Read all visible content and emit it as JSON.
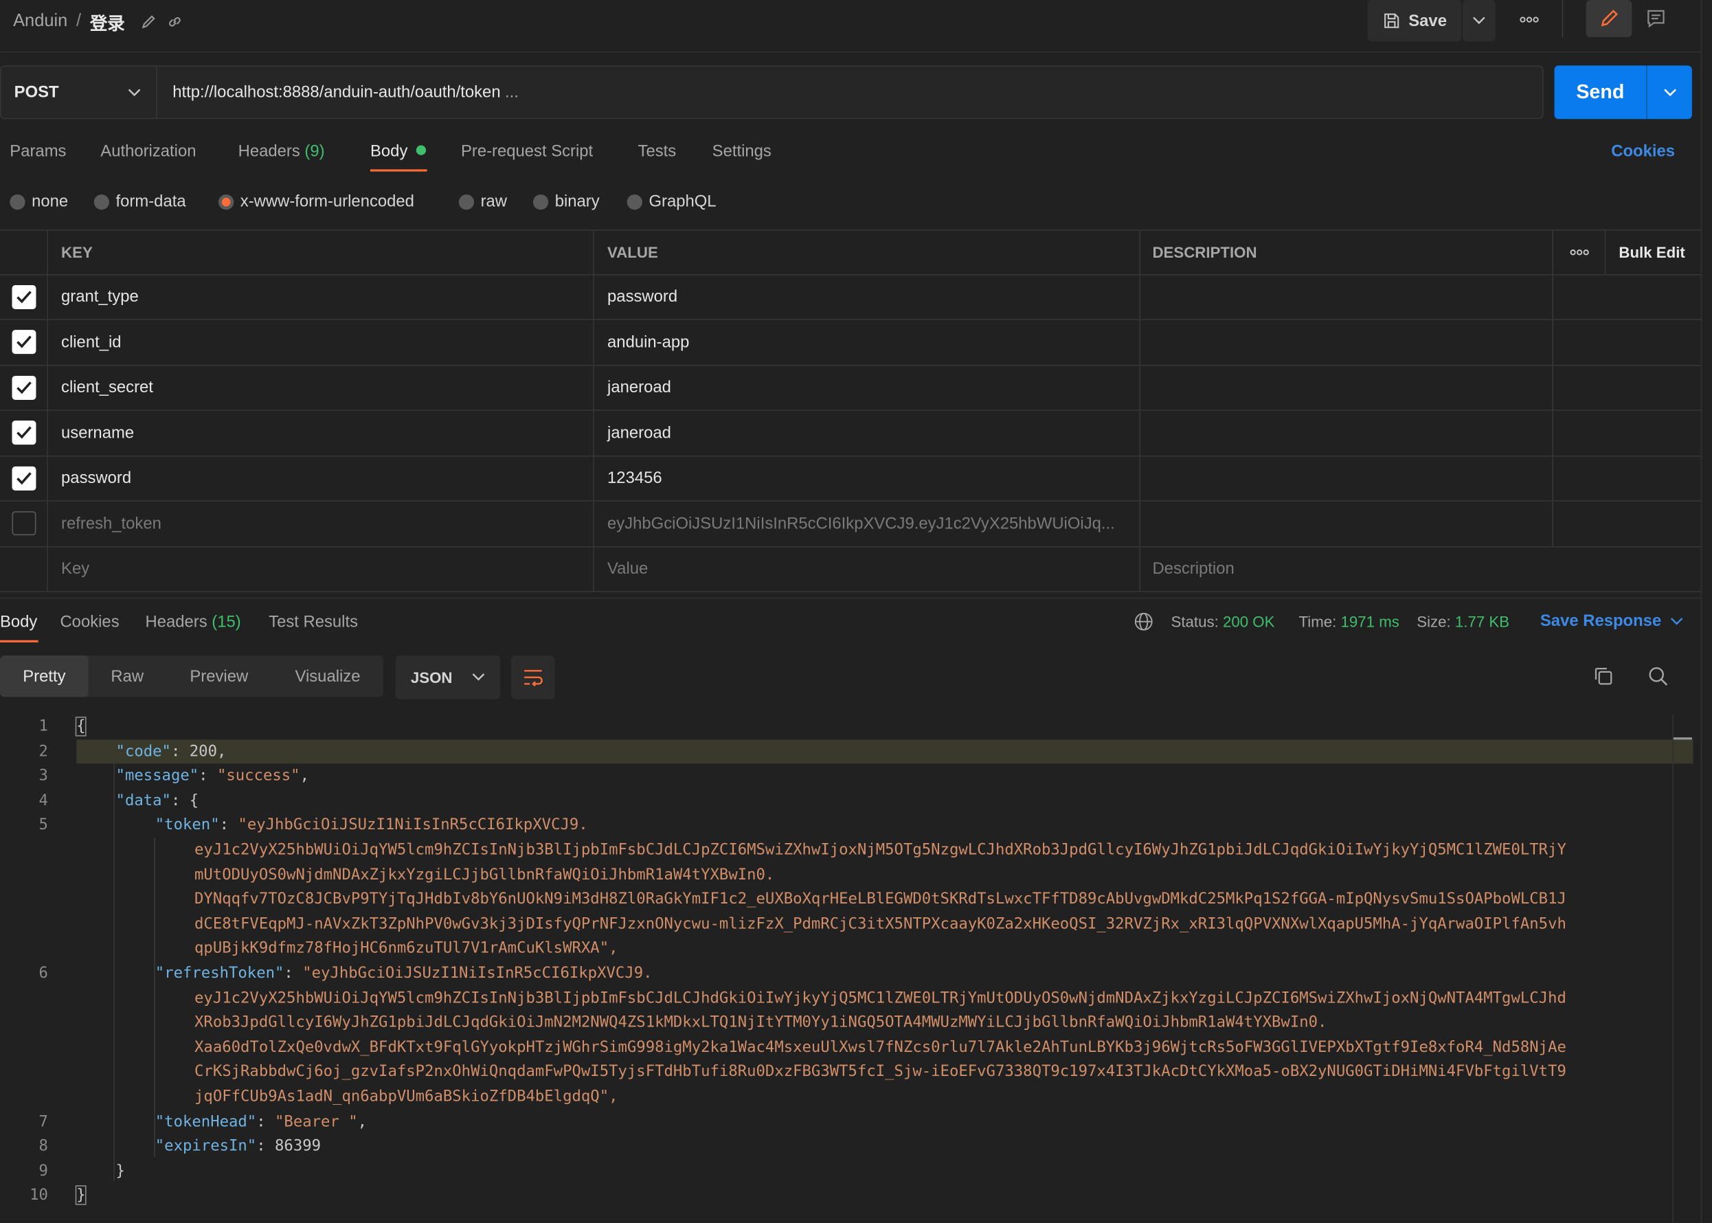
{
  "header": {
    "workspace": "Anduin",
    "separator": "/",
    "request_name": "登录",
    "save_label": "Save",
    "more_label": "ooo"
  },
  "request": {
    "method": "POST",
    "url": "http://localhost:8888/anduin-auth/oauth/token",
    "url_ellipsis": "...",
    "send_label": "Send"
  },
  "tabs": {
    "params": "Params",
    "authorization": "Authorization",
    "headers": "Headers",
    "headers_count": "(9)",
    "body": "Body",
    "prerequest": "Pre-request Script",
    "tests": "Tests",
    "settings": "Settings",
    "cookies": "Cookies"
  },
  "body_types": {
    "none": "none",
    "form_data": "form-data",
    "urlencoded": "x-www-form-urlencoded",
    "raw": "raw",
    "binary": "binary",
    "graphql": "GraphQL"
  },
  "table": {
    "headers": {
      "key": "KEY",
      "value": "VALUE",
      "description": "DESCRIPTION",
      "more": "ooo",
      "bulk_edit": "Bulk Edit"
    },
    "rows": [
      {
        "checked": true,
        "key": "grant_type",
        "value": "password"
      },
      {
        "checked": true,
        "key": "client_id",
        "value": "anduin-app"
      },
      {
        "checked": true,
        "key": "client_secret",
        "value": "janeroad"
      },
      {
        "checked": true,
        "key": "username",
        "value": "janeroad"
      },
      {
        "checked": true,
        "key": "password",
        "value": "123456"
      },
      {
        "checked": false,
        "key": "refresh_token",
        "value": "eyJhbGciOiJSUzI1NiIsInR5cCI6IkpXVCJ9.eyJ1c2VyX25hbWUiOiJq..."
      }
    ],
    "placeholder": {
      "key": "Key",
      "value": "Value",
      "description": "Description"
    }
  },
  "response": {
    "tabs": {
      "body": "Body",
      "cookies": "Cookies",
      "headers": "Headers",
      "headers_count": "(15)",
      "test_results": "Test Results"
    },
    "status_label": "Status:",
    "status_value": "200 OK",
    "time_label": "Time:",
    "time_value": "1971 ms",
    "size_label": "Size:",
    "size_value": "1.77 KB",
    "save_response": "Save Response",
    "view_modes": {
      "pretty": "Pretty",
      "raw": "Raw",
      "preview": "Preview",
      "visualize": "Visualize"
    },
    "format": "JSON",
    "code": {
      "open_brace": "{",
      "close_brace": "}",
      "code_key": "\"code\"",
      "code_val": "200",
      "message_key": "\"message\"",
      "message_val": "\"success\"",
      "data_key": "\"data\"",
      "token_key": "\"token\"",
      "token_lines": [
        "\"eyJhbGciOiJSUzI1NiIsInR5cCI6IkpXVCJ9.",
        "eyJ1c2VyX25hbWUiOiJqYW5lcm9hZCIsInNjb3BlIjpbImFsbCJdLCJpZCI6MSwiZXhwIjoxNjM5OTg5NzgwLCJhdXRob3JpdGllcyI6WyJhZG1pbiJdLCJqdGkiOiIwYjkyYjQ5MC1lZWE0LTRjY",
        "mUtODUyOS0wNjdmNDAxZjkxYzgiLCJjbGllbnRfaWQiOiJhbmR1aW4tYXBwIn0.",
        "DYNqqfv7TOzC8JCBvP9TYjTqJHdbIv8bY6nUOkN9iM3dH8Zl0RaGkYmIF1c2_eUXBoXqrHEeLBlEGWD0tSKRdTsLwxcTFfTD89cAbUvgwDMkdC25MkPq1S2fGGA-mIpQNysvSmu1SsOAPboWLCB1J",
        "dCE8tFVEqpMJ-nAVxZkT3ZpNhPV0wGv3kj3jDIsfyQPrNFJzxnONycwu-mlizFzX_PdmRCjC3itX5NTPXcaayK0Za2xHKeoQSI_32RVZjRx_xRI3lqQPVXNXwlXqapU5MhA-jYqArwaOIPlfAn5vh",
        "qpUBjkK9dfmz78fHojHC6nm6zuTUl7V1rAmCuKlsWRXA\","
      ],
      "refresh_key": "\"refreshToken\"",
      "refresh_lines": [
        "\"eyJhbGciOiJSUzI1NiIsInR5cCI6IkpXVCJ9.",
        "eyJ1c2VyX25hbWUiOiJqYW5lcm9hZCIsInNjb3BlIjpbImFsbCJdLCJhdGkiOiIwYjkyYjQ5MC1lZWE0LTRjYmUtODUyOS0wNjdmNDAxZjkxYzgiLCJpZCI6MSwiZXhwIjoxNjQwNTA4MTgwLCJhd",
        "XRob3JpdGllcyI6WyJhZG1pbiJdLCJqdGkiOiJmN2M2NWQ4ZS1kMDkxLTQ1NjItYTM0Yy1iNGQ5OTA4MWUzMWYiLCJjbGllbnRfaWQiOiJhbmR1aW4tYXBwIn0.",
        "Xaa60dTolZxQe0vdwX_BFdKTxt9FqlGYyokpHTzjWGhrSimG998igMy2ka1Wac4MsxeuUlXwsl7fNZcs0rlu7l7Akle2AhTunLBYKb3j96WjtcRs5oFW3GGlIVEPXbXTgtf9Ie8xfoR4_Nd58NjAe",
        "CrKSjRabbdwCj6oj_gzvIafsP2nxOhWiQnqdamFwPQwI5TyjsFTdHbTufi8Ru0DxzFBG3WT5fcI_Sjw-iEoEFvG7338QT9c197x4I3TJkAcDtCYkXMoa5-oBX2yNUG0GTiDHiMNi4FVbFtgilVtT9",
        "jqOFfCUb9As1adN_qn6abpVUm6aBSkioZfDB4bElgdqQ\","
      ],
      "tokenhead_key": "\"tokenHead\"",
      "tokenhead_val": "\"Bearer \"",
      "expires_key": "\"expiresIn\"",
      "expires_val": "86399",
      "line_numbers": [
        "1",
        "2",
        "3",
        "4",
        "5",
        "6",
        "7",
        "8",
        "9",
        "10"
      ]
    }
  },
  "colors": {
    "accent": "#097bed",
    "tab_indicator": "#ff6c37",
    "success": "#3fbf6c",
    "link": "#3d8ae6"
  }
}
